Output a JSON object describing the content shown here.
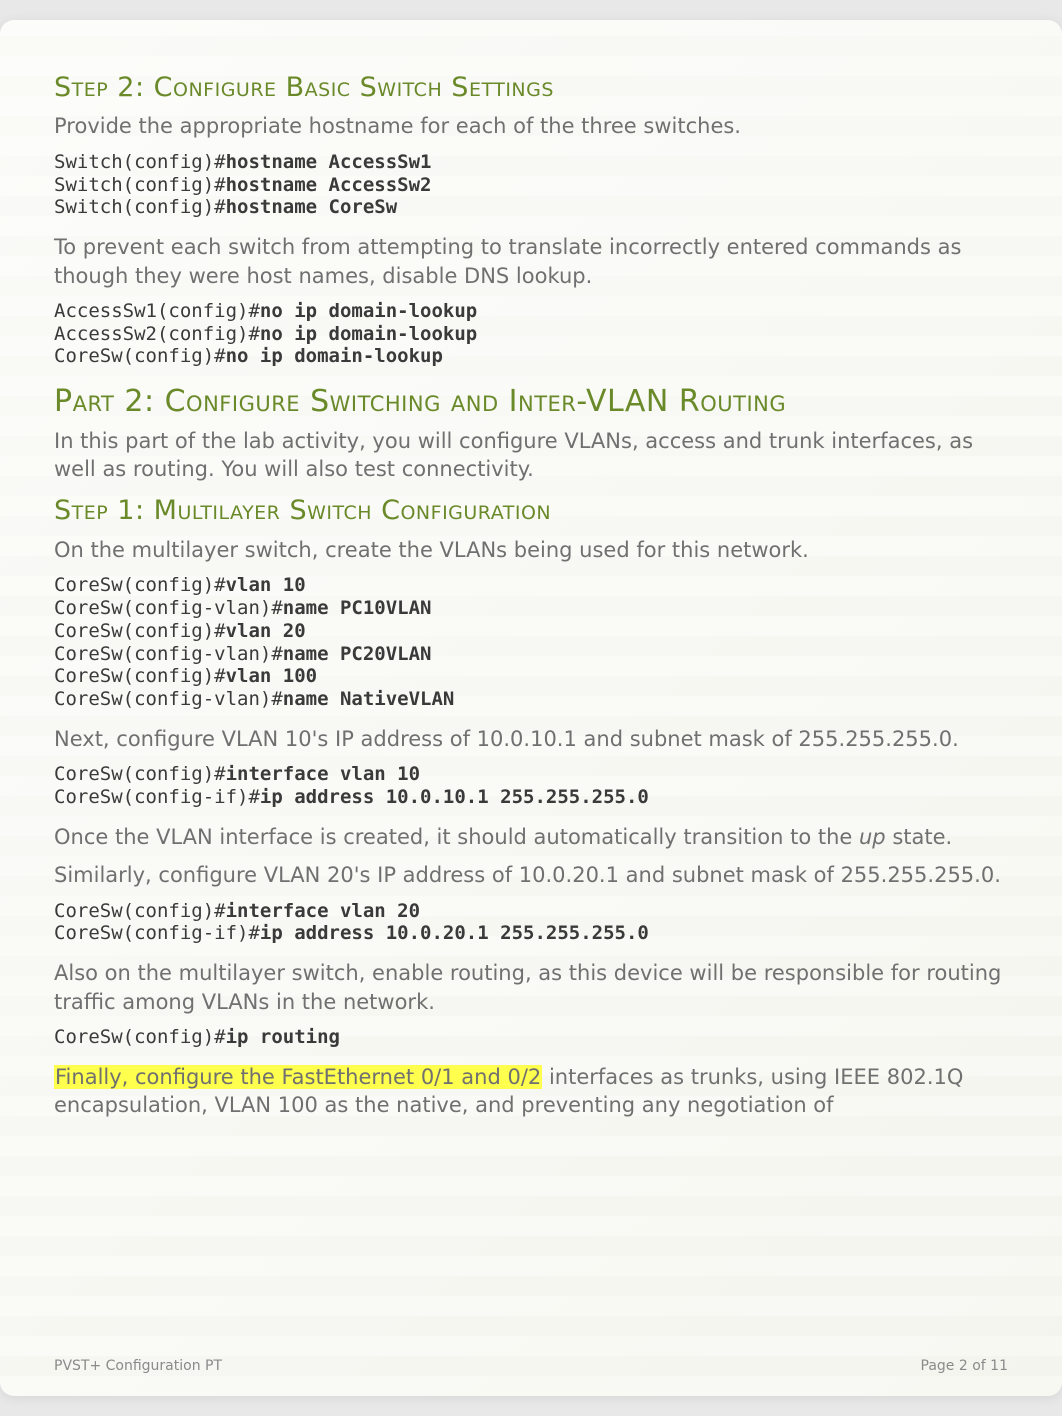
{
  "step2": {
    "title": "Step 2: Configure Basic Switch Settings",
    "intro": "Provide the appropriate hostname for each of the three switches.",
    "code1": "Switch(config)#<b>hostname AccessSw1</b>\nSwitch(config)#<b>hostname AccessSw2</b>\nSwitch(config)#<b>hostname CoreSw</b>",
    "para2": "To prevent each switch from attempting to translate incorrectly entered commands as though they were host names, disable DNS lookup.",
    "code2": "AccessSw1(config)#<b>no ip domain-lookup</b>\nAccessSw2(config)#<b>no ip domain-lookup</b>\nCoreSw(config)#<b>no ip domain-lookup</b>"
  },
  "part2": {
    "title": "Part 2: Configure Switching and Inter-VLAN Routing",
    "intro": "In this part of the lab activity, you will configure VLANs, access and trunk interfaces, as well as routing. You will also test connectivity."
  },
  "step1": {
    "title": "Step 1: Multilayer Switch Configuration",
    "intro": "On the multilayer switch, create the VLANs being used for this network.",
    "code1": "CoreSw(config)#<b>vlan 10</b>\nCoreSw(config-vlan)#<b>name PC10VLAN</b>\nCoreSw(config)#<b>vlan 20</b>\nCoreSw(config-vlan)#<b>name PC20VLAN</b>\nCoreSw(config)#<b>vlan 100</b>\nCoreSw(config-vlan)#<b>name NativeVLAN</b>",
    "para2": "Next, configure VLAN 10's IP address of 10.0.10.1 and subnet mask of 255.255.255.0.",
    "code2": "CoreSw(config)#<b>interface vlan 10</b>\nCoreSw(config-if)#<b>ip address 10.0.10.1 255.255.255.0</b>",
    "para3_a": "Once the VLAN interface is created, it should automatically transition to the ",
    "para3_em": "up",
    "para3_b": " state.",
    "para4": "Similarly, configure VLAN 20's IP address of 10.0.20.1 and subnet mask of 255.255.255.0.",
    "code3": "CoreSw(config)#<b>interface vlan 20</b>\nCoreSw(config-if)#<b>ip address 10.0.20.1 255.255.255.0</b>",
    "para5": "Also on the multilayer switch, enable routing, as this device will be responsible for routing traffic among VLANs in the network.",
    "code4": "CoreSw(config)#<b>ip routing</b>",
    "para6_hl": "Finally, configure the FastEthernet 0/1 and 0/2",
    "para6_rest": " interfaces as trunks, using IEEE 802.1Q encapsulation, VLAN 100 as the native, and preventing any negotiation of"
  },
  "footer": {
    "left": "PVST+ Configuration PT",
    "right": "Page 2 of 11"
  }
}
